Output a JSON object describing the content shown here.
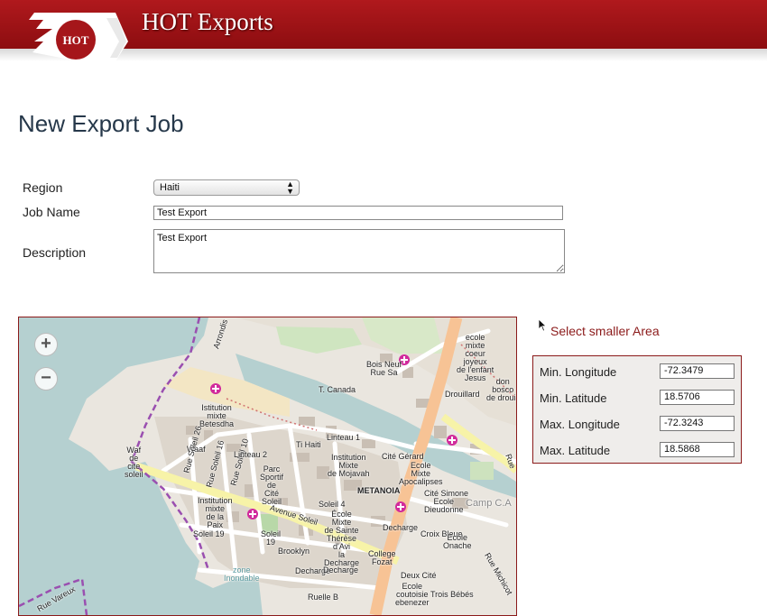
{
  "header": {
    "title": "HOT Exports",
    "logo_text": "HOT",
    "brand_color": "#a5161a"
  },
  "page": {
    "title": "New Export Job"
  },
  "form": {
    "region_label": "Region",
    "region_value": "Haiti",
    "job_name_label": "Job Name",
    "job_name_value": "Test Export",
    "description_label": "Description",
    "description_value": "Test Export"
  },
  "map": {
    "zoom_in": "+",
    "zoom_out": "−",
    "labels": [
      "Arrondis",
      "ecole\nmixte\ncoeur\njoyeux\nde l'enfant\nJesus",
      "Bois Neuf\nRue Sa",
      "T. Canada",
      "Drouillard",
      "don\nbosco\nde drouill",
      "Istitution\nmixte\nBetesdha",
      "Waf\nde\ncite\nsoleil",
      "Waaf",
      "Rue Soleil 26",
      "Rue Soleil 16",
      "Rue Soleil 10",
      "Linteau 2",
      "Ti Haiti",
      "Linteau 1",
      "Institution\nMixte\nde Mojavah",
      "Cité Gérard",
      "Ecole\nMixte\nApocalipses",
      "Parc\nSportif\nde\nCité\nSoleil",
      "METANOIA",
      "Cité Simone",
      "Ecole\nDieudonne",
      "Camp C.A",
      "Institution\nmixte\nde la\nPaix",
      "Avenue Soleil",
      "Soleil 4",
      "École\nMixte\nde Sainte\nThérèse\nd'Avi\nla\nDecharge",
      "Decharge",
      "Croix Bleue",
      "Ecole\nOnache",
      "Soleil 19",
      "Soleil\n19",
      "Brooklyn",
      "Decharge",
      "College\nFozat",
      "zone\nInondable",
      "Decharge",
      "Deux Cité",
      "Ecole\ncoutoisie\nebenezer",
      "Trois Bébés",
      "Rue Michicot",
      "Rue Vareux",
      "Ruelle B",
      "Rue"
    ]
  },
  "sidebar": {
    "select_area_link": "Select smaller Area",
    "bbox": [
      {
        "label": "Min. Longitude",
        "value": "-72.3479"
      },
      {
        "label": "Min. Latitude",
        "value": "18.5706"
      },
      {
        "label": "Max. Longitude",
        "value": "-72.3243"
      },
      {
        "label": "Max. Latitude",
        "value": "18.5868"
      }
    ]
  }
}
